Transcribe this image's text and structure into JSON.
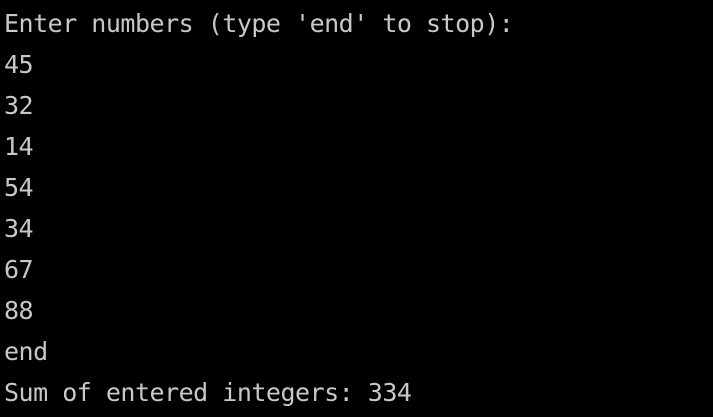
{
  "terminal": {
    "prompt": "Enter numbers (type 'end' to stop):",
    "inputs": [
      "45",
      "32",
      "14",
      "54",
      "34",
      "67",
      "88",
      "end"
    ],
    "result": "Sum of entered integers: 334"
  },
  "colors": {
    "background": "#000000",
    "text": "#c8c8c8"
  }
}
